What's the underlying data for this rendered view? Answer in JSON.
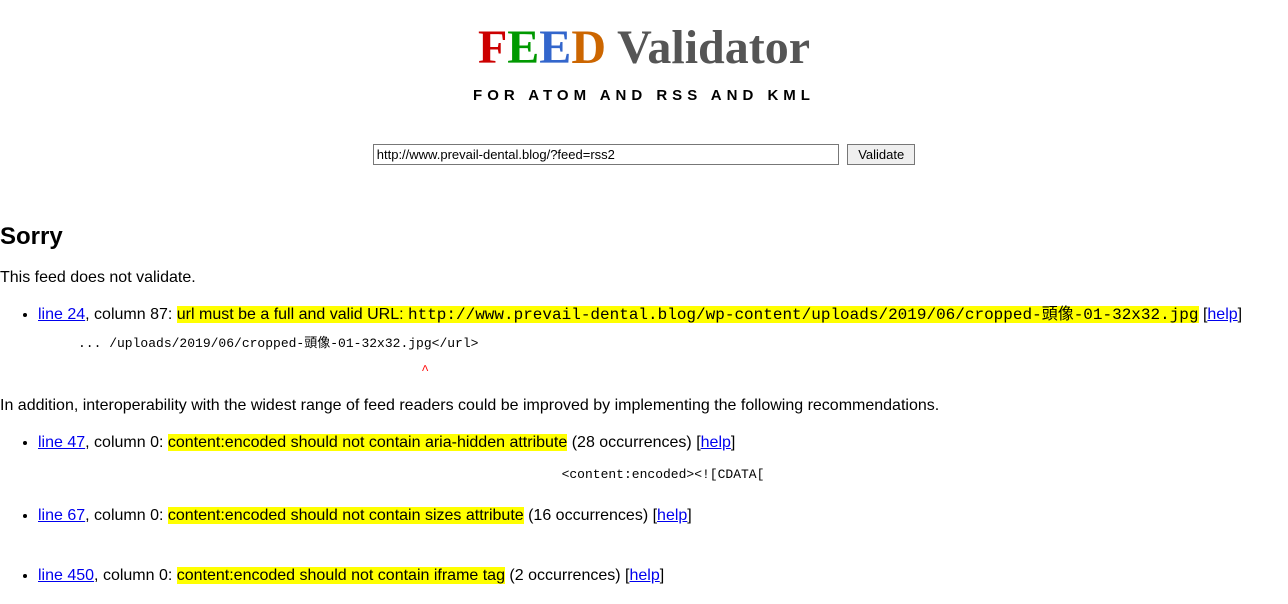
{
  "header": {
    "logo_F": "F",
    "logo_E1": "E",
    "logo_E2": "E",
    "logo_D": "D",
    "logo_rest": " Validator",
    "subtitle": "FOR ATOM AND RSS AND KML"
  },
  "form": {
    "url_value": "http://www.prevail-dental.blog/?feed=rss2",
    "button_label": "Validate"
  },
  "result": {
    "heading": "Sorry",
    "summary": "This feed does not validate.",
    "errors": [
      {
        "line_label": "line 24",
        "after_line": ", column 87: ",
        "message_plain": "url must be a full and valid URL: ",
        "message_mono": "http://www.prevail-dental.blog/wp-content/uploads/2019/06/cropped-頭像-01-32x32.jpg",
        "help": "help",
        "snippet": "... /uploads/2019/06/cropped-頭像-01-32x32.jpg</url>",
        "caret": "                                            ^"
      }
    ],
    "recommend_intro": "In addition, interoperability with the widest range of feed readers could be improved by implementing the following recommendations.",
    "recommendations": [
      {
        "line_label": "line 47",
        "after_line": ", column 0: ",
        "message": "content:encoded should not contain aria-hidden attribute",
        "count": " (28 occurrences) ",
        "help": "help",
        "snippet": "<content:encoded><![CDATA["
      },
      {
        "line_label": "line 67",
        "after_line": ", column 0: ",
        "message": "content:encoded should not contain sizes attribute",
        "count": " (16 occurrences) ",
        "help": "help",
        "snippet": ""
      }
    ],
    "cutoff": {
      "line_label": "line 450",
      "after_line": ", column 0: ",
      "message": "content:encoded should not contain iframe tag",
      "count": " (2 occurrences) ",
      "help": "help"
    }
  }
}
